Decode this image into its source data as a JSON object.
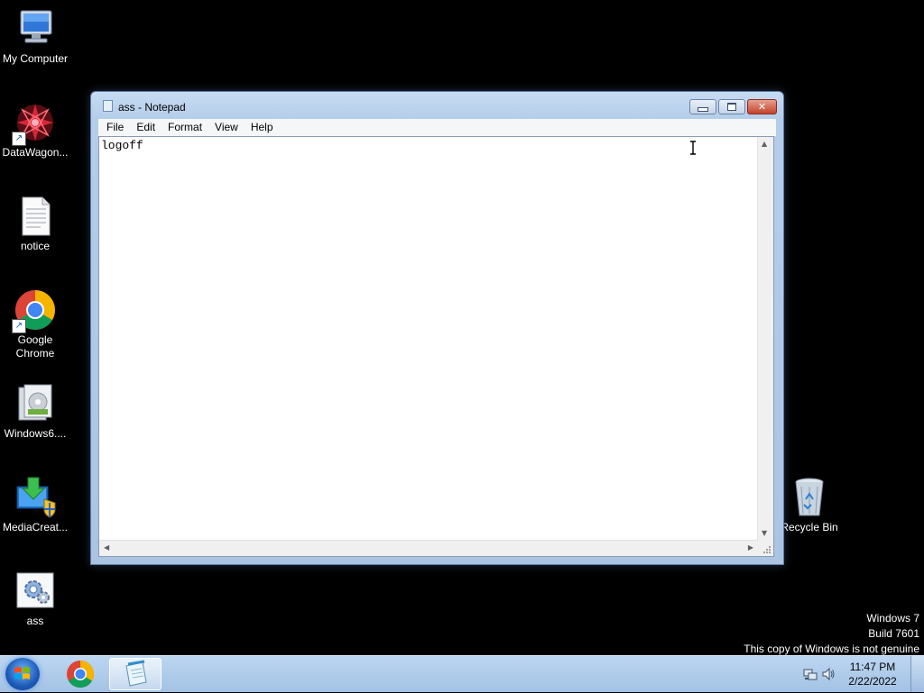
{
  "desktop": {
    "icons": [
      {
        "label": "My Computer",
        "icon": "computer-icon"
      },
      {
        "label": "DataWagon...",
        "icon": "datawagon-icon",
        "shortcut": true
      },
      {
        "label": "notice",
        "icon": "text-file-icon"
      },
      {
        "label": "Google\nChrome",
        "icon": "chrome-icon",
        "shortcut": true
      },
      {
        "label": "Windows6....",
        "icon": "installer-icon"
      },
      {
        "label": "MediaCreat...",
        "icon": "media-creation-icon"
      },
      {
        "label": "ass",
        "icon": "settings-file-icon"
      },
      {
        "label": "Recycle Bin",
        "icon": "recycle-bin-icon"
      }
    ]
  },
  "notepad": {
    "title": "ass - Notepad",
    "menu": [
      "File",
      "Edit",
      "Format",
      "View",
      "Help"
    ],
    "content": "logoff"
  },
  "watermark": {
    "line1": "Windows 7",
    "line2": "Build 7601",
    "line3": "This copy of Windows is not genuine"
  },
  "taskbar": {
    "time": "11:47 PM",
    "date": "2/22/2022",
    "pinned": [
      "chrome-icon",
      "notepad-icon"
    ]
  },
  "colors": {
    "desktop_bg": "#000000",
    "window_frame": "#aac4e2",
    "close_button": "#c4422a",
    "taskbar": "#a3c2e4"
  }
}
